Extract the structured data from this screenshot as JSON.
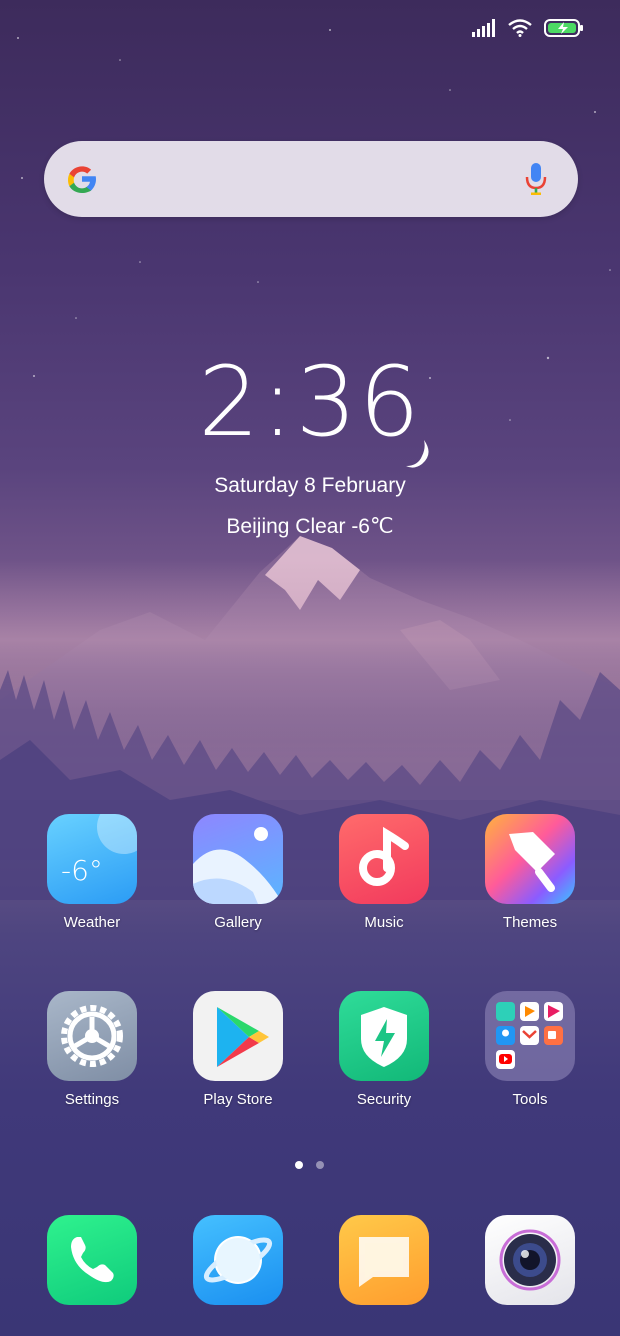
{
  "clock": {
    "time": "2:36"
  },
  "date": "Saturday 8 February",
  "weather_line": "Beijing  Clear  -6℃",
  "apps_row1": [
    {
      "label": "Weather",
      "icon_text": "-6°"
    },
    {
      "label": "Gallery"
    },
    {
      "label": "Music"
    },
    {
      "label": "Themes"
    }
  ],
  "apps_row2": [
    {
      "label": "Settings"
    },
    {
      "label": "Play Store"
    },
    {
      "label": "Security"
    },
    {
      "label": "Tools"
    }
  ],
  "dock": [
    "Phone",
    "Browser",
    "Messages",
    "Camera"
  ],
  "page_indicator": {
    "pages": 2,
    "current": 1
  },
  "colors": {
    "search_bg": "#EEEAF2",
    "weather_icon": "#3fb3f5",
    "music_icon": "#f5434f",
    "security_icon": "#1dc786",
    "phone_icon": "#16d98a",
    "browser_icon": "#2aa6f7",
    "messages_icon": "#ffb23d"
  }
}
